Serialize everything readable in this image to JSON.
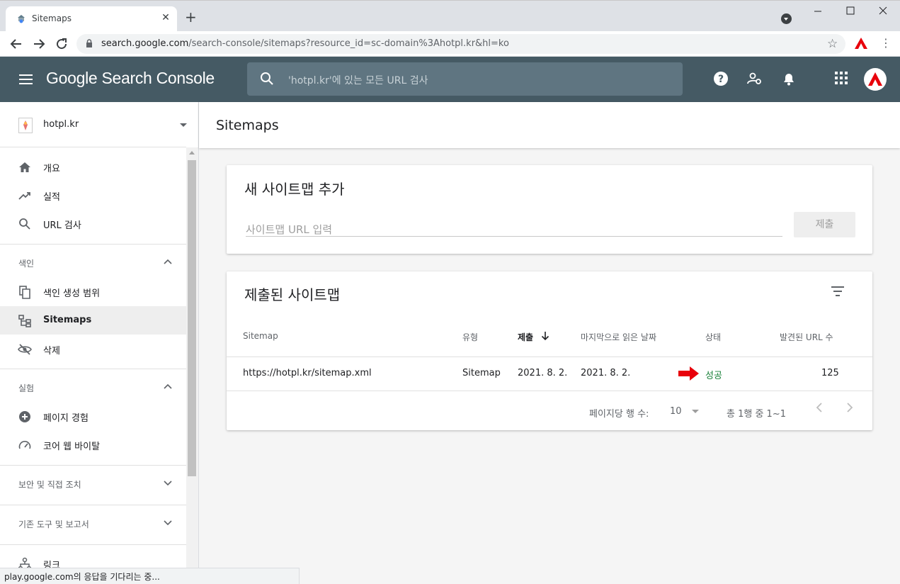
{
  "browser": {
    "tab_title": "Sitemaps",
    "tab_close": "✕",
    "new_tab": "+",
    "url_host": "search.google.com",
    "url_path": "/search-console/sitemaps?resource_id=sc-domain%3Ahotpl.kr&hl=ko",
    "status_text": "play.google.com의 응답을 기다리는 중..."
  },
  "header": {
    "brand": "Google Search Console",
    "search_placeholder": "'hotpl.kr'에 있는 모든 URL 검사"
  },
  "sidebar": {
    "property": "hotpl.kr",
    "items_top": [
      {
        "label": "개요",
        "icon": "home-icon"
      },
      {
        "label": "실적",
        "icon": "trending-icon"
      },
      {
        "label": "URL 검사",
        "icon": "search-icon"
      }
    ],
    "section_index": "색인",
    "items_index": [
      {
        "label": "색인 생성 범위",
        "icon": "copy-icon"
      },
      {
        "label": "Sitemaps",
        "icon": "sitemap-icon"
      },
      {
        "label": "삭제",
        "icon": "eye-off-icon"
      }
    ],
    "section_experience": "실험",
    "items_experience": [
      {
        "label": "페이지 경험",
        "icon": "plus-circle-icon"
      },
      {
        "label": "코어 웹 바이탈",
        "icon": "gauge-icon"
      }
    ],
    "section_security": "보안 및 직접 조치",
    "section_legacy": "기존 도구 및 보고서",
    "items_bottom": [
      {
        "label": "링크",
        "icon": "link-tree-icon"
      }
    ]
  },
  "main": {
    "page_title": "Sitemaps",
    "add_card": {
      "title": "새 사이트맵 추가",
      "input_placeholder": "사이트맵 URL 입력",
      "submit_label": "제출"
    },
    "submitted_card": {
      "title": "제출된 사이트맵",
      "columns": [
        "Sitemap",
        "유형",
        "제출",
        "마지막으로 읽은 날짜",
        "상태",
        "발견된 URL 수"
      ],
      "rows": [
        {
          "sitemap": "https://hotpl.kr/sitemap.xml",
          "type": "Sitemap",
          "submitted": "2021. 8. 2.",
          "last_read": "2021. 8. 2.",
          "status": "성공",
          "urls": "125"
        }
      ],
      "rows_per_page_label": "페이지당 행 수:",
      "rows_per_page": "10",
      "range_label": "총 1행 중 1~1"
    }
  },
  "colors": {
    "header_bg": "#455a64",
    "status_success": "#188038",
    "annotation_arrow": "#e8000b"
  }
}
